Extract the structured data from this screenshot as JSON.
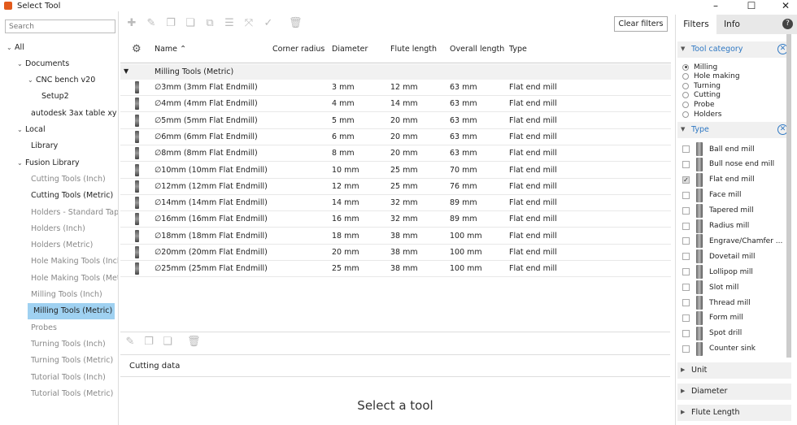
{
  "window": {
    "title": "Select Tool",
    "controls": [
      "–",
      "☐",
      "✕"
    ]
  },
  "search": {
    "placeholder": "Search"
  },
  "tree": [
    {
      "label": "All",
      "level": 0,
      "chev": "⌄",
      "gray": false
    },
    {
      "label": "Documents",
      "level": 1,
      "chev": "⌄",
      "gray": false
    },
    {
      "label": "CNC bench v20",
      "level": 2,
      "chev": "⌄",
      "gray": false
    },
    {
      "label": "Setup2",
      "level": 3,
      "chev": "",
      "gray": false
    },
    {
      "label": "autodesk 3ax table xy h",
      "level": 2,
      "chev": "",
      "gray": false
    },
    {
      "label": "Local",
      "level": 1,
      "chev": "⌄",
      "gray": false
    },
    {
      "label": "Library",
      "level": 2,
      "chev": "",
      "gray": false
    },
    {
      "label": "Fusion Library",
      "level": 1,
      "chev": "⌄",
      "gray": false
    },
    {
      "label": "Cutting Tools (Inch)",
      "level": 2,
      "chev": "",
      "gray": true
    },
    {
      "label": "Cutting Tools (Metric)",
      "level": 2,
      "chev": "",
      "gray": false
    },
    {
      "label": "Holders - Standard Tap",
      "level": 2,
      "chev": "",
      "gray": true
    },
    {
      "label": "Holders (Inch)",
      "level": 2,
      "chev": "",
      "gray": true
    },
    {
      "label": "Holders (Metric)",
      "level": 2,
      "chev": "",
      "gray": true
    },
    {
      "label": "Hole Making Tools (Inch",
      "level": 2,
      "chev": "",
      "gray": true
    },
    {
      "label": "Hole Making Tools (Met",
      "level": 2,
      "chev": "",
      "gray": true
    },
    {
      "label": "Milling Tools (Inch)",
      "level": 2,
      "chev": "",
      "gray": true
    },
    {
      "label": "Milling Tools (Metric)",
      "level": 2,
      "chev": "",
      "gray": false,
      "selected": true
    },
    {
      "label": "Probes",
      "level": 2,
      "chev": "",
      "gray": true
    },
    {
      "label": "Turning Tools (Inch)",
      "level": 2,
      "chev": "",
      "gray": true
    },
    {
      "label": "Turning Tools (Metric)",
      "level": 2,
      "chev": "",
      "gray": true
    },
    {
      "label": "Tutorial Tools (Inch)",
      "level": 2,
      "chev": "",
      "gray": true
    },
    {
      "label": "Tutorial Tools (Metric)",
      "level": 2,
      "chev": "",
      "gray": true
    }
  ],
  "toolbar": {
    "icons": [
      "add-icon",
      "edit-icon",
      "copy-icon",
      "paste-icon",
      "duplicate-icon",
      "holder-icon",
      "transform-icon",
      "measure-icon",
      "delete-icon"
    ],
    "clear_filters": "Clear filters"
  },
  "table": {
    "headers": {
      "name": "Name",
      "corner_radius": "Corner radius",
      "diameter": "Diameter",
      "flute_length": "Flute length",
      "overall_length": "Overall length",
      "type": "Type"
    },
    "sort_indicator": "⌃",
    "group_label": "Milling Tools (Metric)",
    "rows": [
      {
        "name": "∅3mm (3mm Flat Endmill)",
        "diameter": "3 mm",
        "flute": "12 mm",
        "overall": "63 mm",
        "type": "Flat end mill"
      },
      {
        "name": "∅4mm (4mm Flat Endmill)",
        "diameter": "4 mm",
        "flute": "14 mm",
        "overall": "63 mm",
        "type": "Flat end mill"
      },
      {
        "name": "∅5mm (5mm Flat Endmill)",
        "diameter": "5 mm",
        "flute": "20 mm",
        "overall": "63 mm",
        "type": "Flat end mill"
      },
      {
        "name": "∅6mm (6mm Flat Endmill)",
        "diameter": "6 mm",
        "flute": "20 mm",
        "overall": "63 mm",
        "type": "Flat end mill"
      },
      {
        "name": "∅8mm (8mm Flat Endmill)",
        "diameter": "8 mm",
        "flute": "20 mm",
        "overall": "63 mm",
        "type": "Flat end mill"
      },
      {
        "name": "∅10mm (10mm Flat Endmill)",
        "diameter": "10 mm",
        "flute": "25 mm",
        "overall": "70 mm",
        "type": "Flat end mill"
      },
      {
        "name": "∅12mm (12mm Flat Endmill)",
        "diameter": "12 mm",
        "flute": "25 mm",
        "overall": "76 mm",
        "type": "Flat end mill"
      },
      {
        "name": "∅14mm (14mm Flat Endmill)",
        "diameter": "14 mm",
        "flute": "32 mm",
        "overall": "89 mm",
        "type": "Flat end mill"
      },
      {
        "name": "∅16mm (16mm Flat Endmill)",
        "diameter": "16 mm",
        "flute": "32 mm",
        "overall": "89 mm",
        "type": "Flat end mill"
      },
      {
        "name": "∅18mm (18mm Flat Endmill)",
        "diameter": "18 mm",
        "flute": "38 mm",
        "overall": "100 mm",
        "type": "Flat end mill"
      },
      {
        "name": "∅20mm (20mm Flat Endmill)",
        "diameter": "20 mm",
        "flute": "38 mm",
        "overall": "100 mm",
        "type": "Flat end mill"
      },
      {
        "name": "∅25mm (25mm Flat Endmill)",
        "diameter": "25 mm",
        "flute": "38 mm",
        "overall": "100 mm",
        "type": "Flat end mill"
      }
    ]
  },
  "cutting_data": {
    "label": "Cutting data"
  },
  "placeholder": {
    "select_tool": "Select a tool"
  },
  "filters": {
    "tabs": {
      "filters": "Filters",
      "info": "Info"
    },
    "help": "?",
    "tool_category": {
      "label": "Tool category",
      "options": [
        "Milling",
        "Hole making",
        "Turning",
        "Cutting",
        "Probe",
        "Holders"
      ],
      "selected": "Milling"
    },
    "type": {
      "label": "Type",
      "options": [
        "Ball end mill",
        "Bull nose end mill",
        "Flat end mill",
        "Face mill",
        "Tapered mill",
        "Radius mill",
        "Engrave/Chamfer ...",
        "Dovetail mill",
        "Lollipop mill",
        "Slot mill",
        "Thread mill",
        "Form mill",
        "Spot drill",
        "Counter sink"
      ],
      "checked": "Flat end mill"
    },
    "collapsed": [
      "Unit",
      "Diameter",
      "Flute Length"
    ]
  }
}
